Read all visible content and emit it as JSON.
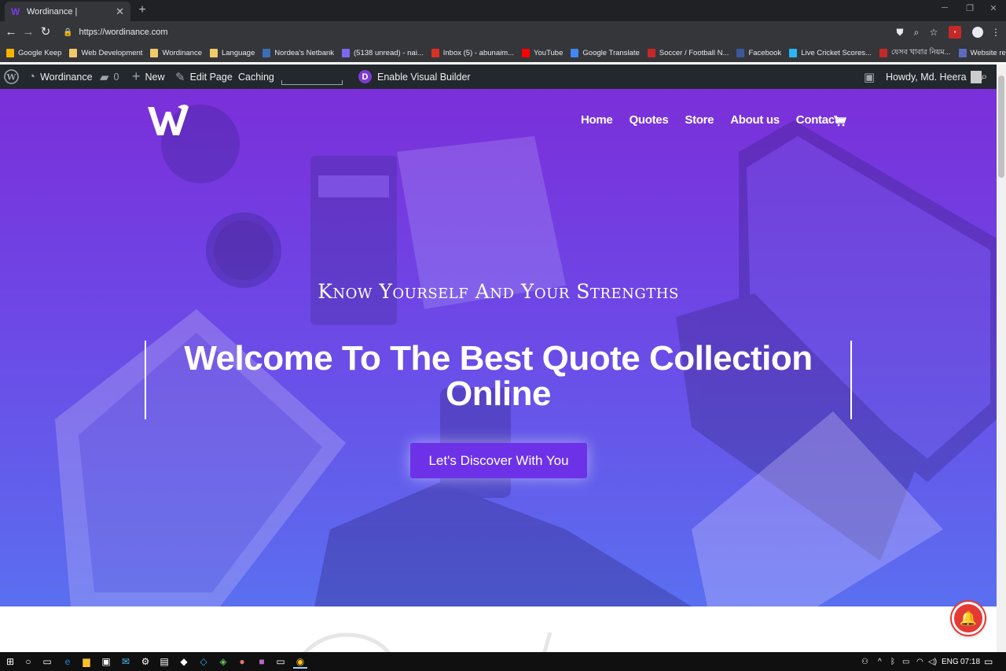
{
  "browser": {
    "tab_title": "Wordinance |",
    "tab_favicon": "W",
    "url": "https://wordinance.com",
    "bookmarks": [
      {
        "label": "Google Keep",
        "color": "#f4b400"
      },
      {
        "label": "Web Development",
        "color": "#f0c96b"
      },
      {
        "label": "Wordinance",
        "color": "#f0c96b"
      },
      {
        "label": "Language",
        "color": "#f0c96b"
      },
      {
        "label": "Nordea's Netbank",
        "color": "#3b6fb6"
      },
      {
        "label": "(5138 unread) - nai...",
        "color": "#7b68ee"
      },
      {
        "label": "Inbox (5) - abunaim...",
        "color": "#d93025"
      },
      {
        "label": "YouTube",
        "color": "#ff0000"
      },
      {
        "label": "Google Translate",
        "color": "#4285f4"
      },
      {
        "label": "Soccer / Football N...",
        "color": "#c62828"
      },
      {
        "label": "Facebook",
        "color": "#3b5998"
      },
      {
        "label": "Live Cricket Scores...",
        "color": "#29b6f6"
      },
      {
        "label": "যেসব খাবার নিয়ম...",
        "color": "#c62828"
      },
      {
        "label": "Website review | tec...",
        "color": "#5c6bc0"
      }
    ]
  },
  "wp_admin": {
    "site_name": "Wordinance",
    "comments_count": "0",
    "new_label": "New",
    "edit_label": "Edit Page",
    "caching_label": "Caching",
    "visual_builder_label": "Enable Visual Builder",
    "howdy_label": "Howdy, Md. Heera"
  },
  "site": {
    "nav": [
      "Home",
      "Quotes",
      "Store",
      "About us",
      "Contact"
    ],
    "subheading": "Know Yourself And Your Strengths",
    "headline": "Welcome To The Best Quote Collection Online",
    "cta_label": "Let's Discover With You",
    "colors": {
      "hero_top": "#7b2fd9",
      "hero_bottom": "#5a6ff0",
      "cta_bg": "#6d32e8",
      "notification_bell": "#e53935"
    }
  },
  "taskbar": {
    "language": "ENG",
    "time": "07:18"
  }
}
